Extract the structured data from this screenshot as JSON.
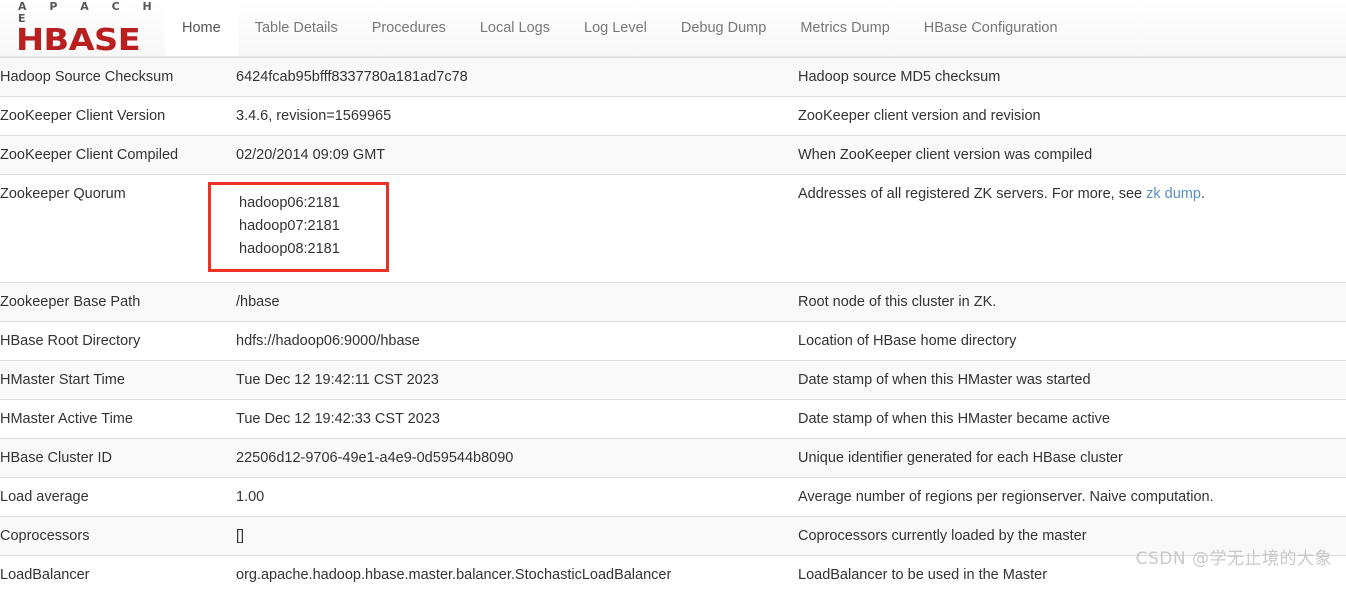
{
  "brand": {
    "apache_text": "A P A C H E",
    "hbase_text": "HBASE",
    "hbase_color": "#ba1f1f",
    "apache_color": "#575757"
  },
  "nav": {
    "items": [
      {
        "label": "Home",
        "active": true
      },
      {
        "label": "Table Details",
        "active": false
      },
      {
        "label": "Procedures",
        "active": false
      },
      {
        "label": "Local Logs",
        "active": false
      },
      {
        "label": "Log Level",
        "active": false
      },
      {
        "label": "Debug Dump",
        "active": false
      },
      {
        "label": "Metrics Dump",
        "active": false
      },
      {
        "label": "HBase Configuration",
        "active": false
      }
    ]
  },
  "table": {
    "rows": [
      {
        "name": "Hadoop Source Checksum",
        "value": "6424fcab95bfff8337780a181ad7c78",
        "description": "Hadoop source MD5 checksum"
      },
      {
        "name": "ZooKeeper Client Version",
        "value": "3.4.6, revision=1569965",
        "description": "ZooKeeper client version and revision"
      },
      {
        "name": "ZooKeeper Client Compiled",
        "value": "02/20/2014 09:09 GMT",
        "description": "When ZooKeeper client version was compiled"
      },
      {
        "name": "Zookeeper Quorum",
        "value_lines": [
          "hadoop06:2181",
          "hadoop07:2181",
          "hadoop08:2181"
        ],
        "description_prefix": "Addresses of all registered ZK servers. For more, see ",
        "description_link": "zk dump",
        "description_suffix": "."
      },
      {
        "name": "Zookeeper Base Path",
        "value": "/hbase",
        "description": "Root node of this cluster in ZK."
      },
      {
        "name": "HBase Root Directory",
        "value": "hdfs://hadoop06:9000/hbase",
        "description": "Location of HBase home directory"
      },
      {
        "name": "HMaster Start Time",
        "value": "Tue Dec 12 19:42:11 CST 2023",
        "description": "Date stamp of when this HMaster was started"
      },
      {
        "name": "HMaster Active Time",
        "value": "Tue Dec 12 19:42:33 CST 2023",
        "description": "Date stamp of when this HMaster became active"
      },
      {
        "name": "HBase Cluster ID",
        "value": "22506d12-9706-49e1-a4e9-0d59544b8090",
        "description": "Unique identifier generated for each HBase cluster"
      },
      {
        "name": "Load average",
        "value": "1.00",
        "description": "Average number of regions per regionserver. Naive computation."
      },
      {
        "name": "Coprocessors",
        "value": "[]",
        "description": "Coprocessors currently loaded by the master"
      },
      {
        "name": "LoadBalancer",
        "value": "org.apache.hadoop.hbase.master.balancer.StochasticLoadBalancer",
        "description": "LoadBalancer to be used in the Master"
      }
    ]
  },
  "annotation": {
    "highlight_color": "#ee3124",
    "highlight_target": "Zookeeper Quorum"
  },
  "watermark": {
    "text": "CSDN @学无止境的大象",
    "color": "#c9c9c9"
  }
}
